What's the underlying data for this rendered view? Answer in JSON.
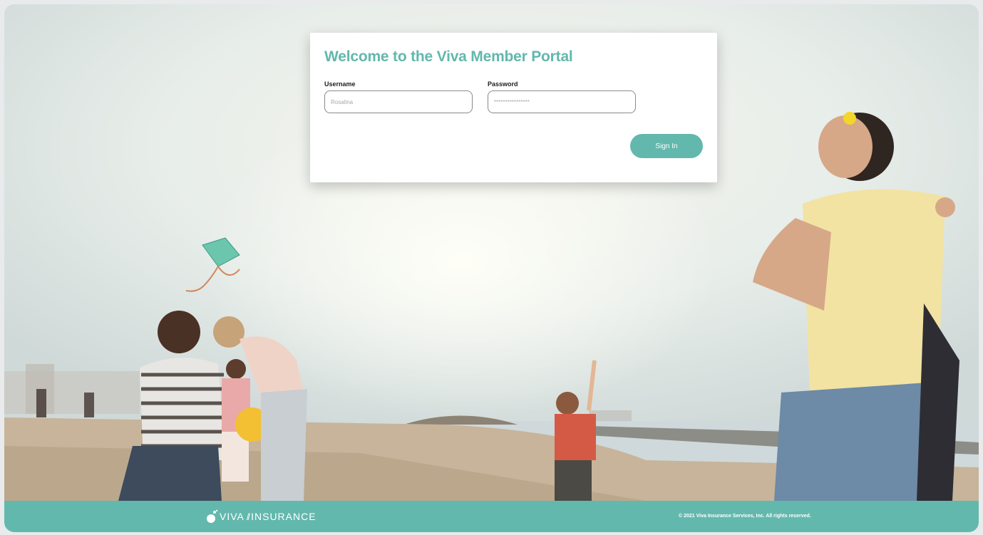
{
  "login": {
    "title": "Welcome to the Viva Member Portal",
    "username_label": "Username",
    "username_value": "Rosalina",
    "password_label": "Password",
    "password_value": "****************",
    "signin_label": "Sign In"
  },
  "footer": {
    "logo_viva": "VIVA",
    "logo_separator": "//",
    "logo_insurance": "INSURANCE",
    "copyright": "© 2021 Viva Insurance Services, Inc. All rights reserved."
  },
  "colors": {
    "brand_teal": "#62b8ac",
    "footer_teal": "#63b8ae"
  },
  "icons": {
    "logo": "viva-logo-mark"
  }
}
